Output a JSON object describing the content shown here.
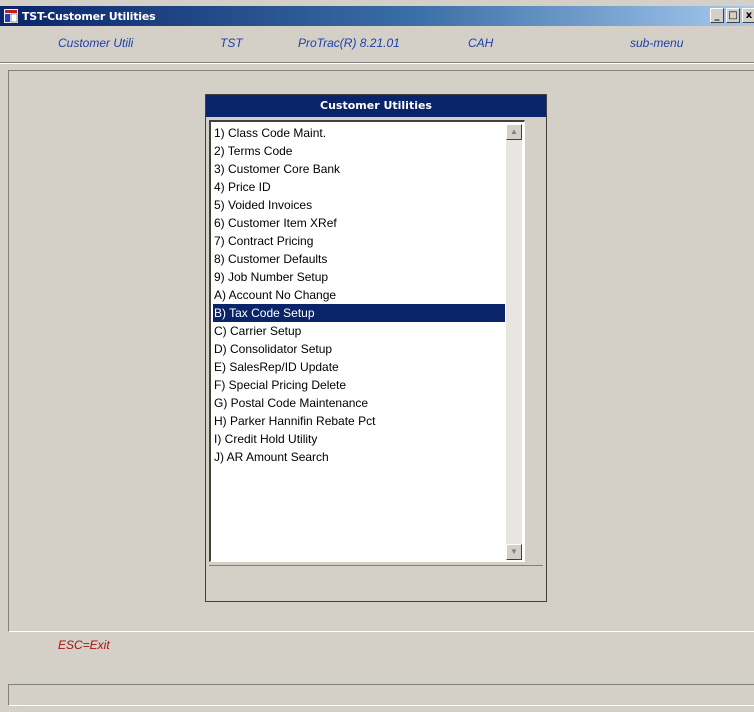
{
  "window": {
    "title": "TST-Customer Utilities",
    "controls": {
      "minimize": "_",
      "maximize": "□",
      "close": "x"
    }
  },
  "infobar": {
    "module": "Customer Utili",
    "company": "TST",
    "version": "ProTrac(R) 8.21.01",
    "user": "CAH",
    "context": "sub-menu"
  },
  "menu": {
    "title": "Customer Utilities",
    "selected_index": 10,
    "items": [
      "1) Class Code Maint.",
      "2) Terms Code",
      "3) Customer Core Bank",
      "4) Price ID",
      "5) Voided Invoices",
      "6) Customer Item XRef",
      "7) Contract Pricing",
      "8) Customer Defaults",
      "9) Job Number Setup",
      "A) Account No Change",
      "B) Tax Code Setup",
      "C) Carrier Setup",
      "D) Consolidator Setup",
      "E) SalesRep/ID Update",
      "F) Special Pricing Delete",
      "G) Postal Code Maintenance",
      "H) Parker Hannifin Rebate Pct",
      "I) Credit Hold Utility",
      "J) AR Amount Search"
    ]
  },
  "footer": {
    "esc_hint": "ESC=Exit",
    "status_text": ""
  },
  "colors": {
    "title_bar": "#0a246a",
    "selection": "#0a246a",
    "info_text": "#1e3fa8",
    "esc_text": "#a01515",
    "face": "#d4d0c8"
  },
  "icons": {
    "app": "app-window-icon",
    "scroll_up": "arrow-up-icon",
    "scroll_down": "arrow-down-icon"
  }
}
